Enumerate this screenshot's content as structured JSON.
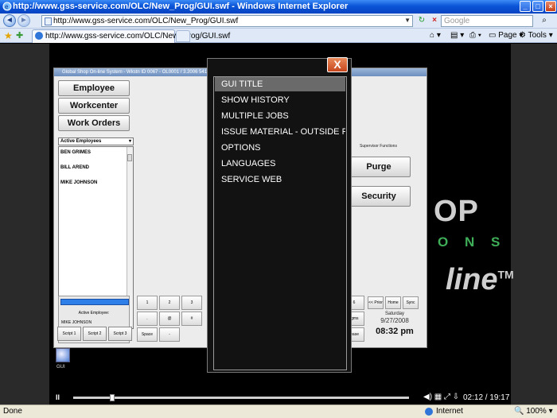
{
  "window": {
    "title": "http://www.gss-service.com/OLC/New_Prog/GUI.swf - Windows Internet Explorer",
    "minimize": "_",
    "maximize": "□",
    "close": "×"
  },
  "navbar": {
    "address": "http://www.gss-service.com/OLC/New_Prog/GUI.swf",
    "search_placeholder": "Google",
    "back": "◄",
    "forward": "►"
  },
  "tabs": {
    "active_tab": "http://www.gss-service.com/OLC/New_Prog/GUI.swf"
  },
  "toolbar": {
    "page": "Page",
    "tools": "Tools"
  },
  "gss_app": {
    "title": "Global Shop On-line System - Wkstn ID 0067 - OL0001 / 3.2006 5410",
    "buttons": [
      "Employee",
      "Workcenter",
      "Work Orders"
    ],
    "employee_filter": "Active Employees",
    "employees": [
      "BEN GRIMES",
      "BILL AREND",
      "MIKE JOHNSON"
    ],
    "active_employee_label": "Active Employee:",
    "active_employee_name": "MIKE JOHNSON",
    "scripts": [
      "Script 1",
      "Script 2",
      "Script 3"
    ],
    "keypad_row1": [
      "1",
      "2",
      "3"
    ],
    "keypad_row2": [
      ".",
      "@",
      "#"
    ],
    "keypad_row3": [
      "Space",
      "-"
    ],
    "right_keys": [
      "<< Prior",
      "Home",
      "Sync"
    ],
    "keypad_partial": [
      "6",
      "rgms",
      "lease"
    ],
    "supervisor_label": "Supervisor Functions",
    "purge": "Purge",
    "security": "Security",
    "date_day": "Saturday",
    "date": "9/27/2008",
    "time": "08:32 pm"
  },
  "logo": {
    "line1": "OP",
    "line2": "O N S",
    "line3": "line",
    "tm": "TM"
  },
  "gui_icon_label": "GUI",
  "popup": {
    "close_label": "X",
    "items": [
      "GUI TITLE",
      "SHOW HISTORY",
      "MULTIPLE JOBS",
      "ISSUE MATERIAL - OUTSIDE P",
      "OPTIONS",
      "LANGUAGES",
      "SERVICE WEB"
    ],
    "selected_index": 0
  },
  "video": {
    "play_label": "II",
    "time": "02:12 / 19:17",
    "progress": 0.115
  },
  "status": {
    "left": "Done",
    "zone": "Internet",
    "zoom": "100%"
  }
}
